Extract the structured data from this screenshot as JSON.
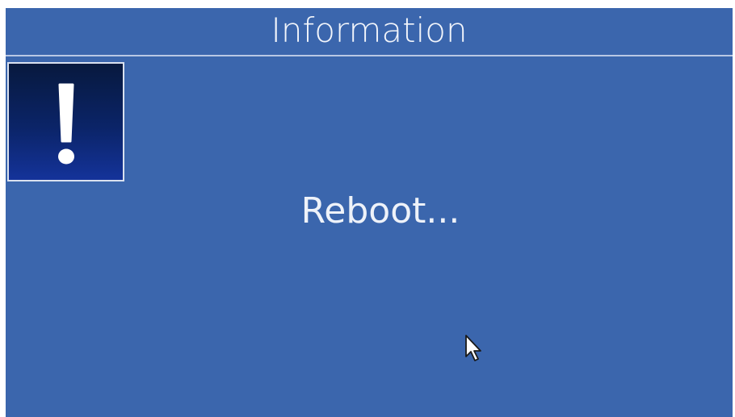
{
  "dialog": {
    "title": "Information",
    "message": "Reboot...",
    "icon": "exclamation-icon"
  },
  "colors": {
    "background": "#3b66ad",
    "icon_box": "#0b2468",
    "text": "#ffffff"
  },
  "cursor": {
    "icon": "mouse-pointer-icon"
  }
}
